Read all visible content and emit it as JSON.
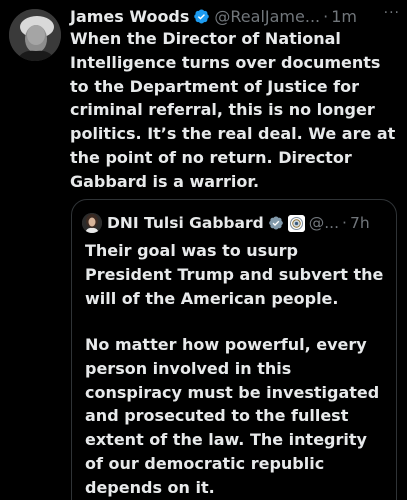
{
  "post": {
    "author_name": "James Woods",
    "author_handle": "@RealJame...",
    "separator": "·",
    "time": "1m",
    "more_glyph": "···",
    "text": "When the Director of National Intelligence turns over documents to the Department of Justice for criminal referral, this is no longer politics. It’s the real deal. We are at the point of no return. Director Gabbard is a warrior."
  },
  "quote": {
    "author_name": "DNI Tulsi Gabbard",
    "author_handle": "@...",
    "separator": "·",
    "time": "7h",
    "paragraph_1": "Their goal was to usurp President Trump and subvert the will of the American people.",
    "paragraph_2": "No matter how powerful, every person involved in this conspiracy must be investigated and prosecuted to the fullest extent of the law. The integrity of our democratic republic depends on it."
  },
  "icons": {
    "verified": "verified-badge-icon",
    "seal": "government-seal-icon",
    "more": "more-options-icon"
  },
  "colors": {
    "background": "#000000",
    "text": "#e7e9ea",
    "muted": "#71767b",
    "verified_blue": "#1d9bf0",
    "verified_gray": "#829aab",
    "border": "#2f3336"
  }
}
